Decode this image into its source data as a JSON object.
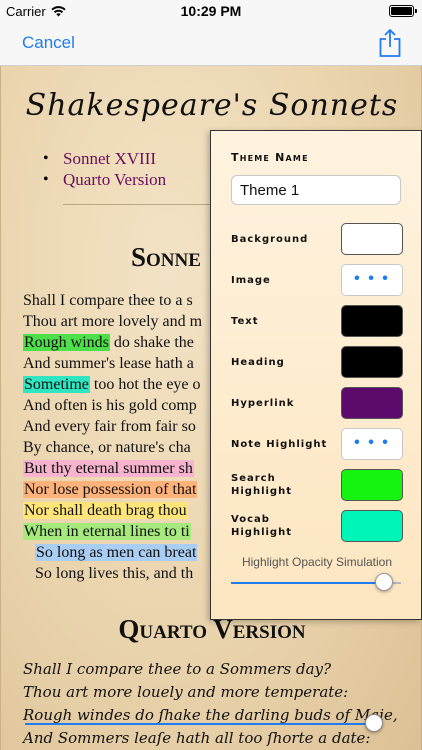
{
  "status_bar": {
    "carrier": "Carrier",
    "time": "10:29 PM",
    "wifi_icon": "wifi-icon",
    "battery_icon": "battery-icon",
    "battery_level": 1.0
  },
  "nav": {
    "cancel_label": "Cancel",
    "share_icon": "share-icon",
    "accent_color": "#1f7cf0"
  },
  "book": {
    "title": "Shakespeare's Sonnets",
    "toc": [
      {
        "label": "Sonnet XVIII",
        "link_color": "#6b0f5b"
      },
      {
        "label": "Quarto Version",
        "link_color": "#6b0f5b"
      }
    ],
    "heading_1": "Sonne",
    "lines": [
      {
        "pre": "Shall I compare thee to a s",
        "hl": "",
        "post": "",
        "color": ""
      },
      {
        "pre": "Thou art more lovely and m",
        "hl": "",
        "post": "",
        "color": ""
      },
      {
        "pre": "",
        "hl": "Rough winds",
        "post": " do shake the",
        "color": "#4ee04a"
      },
      {
        "pre": "And summer's lease hath a",
        "hl": "",
        "post": "",
        "color": ""
      },
      {
        "pre": "",
        "hl": "Sometime",
        "post": " too hot the eye o",
        "color": "#2ee6c1"
      },
      {
        "pre": "And often is his gold comp",
        "hl": "",
        "post": "",
        "color": ""
      },
      {
        "pre": "And every fair from fair so",
        "hl": "",
        "post": "",
        "color": ""
      },
      {
        "pre": "By chance, or nature's cha",
        "hl": "",
        "post": "",
        "color": ""
      },
      {
        "pre": "",
        "hl": "But thy eternal summer sh",
        "post": "",
        "color": "#f7b3cf"
      },
      {
        "pre": "",
        "hl": "Nor lose possession of that",
        "post": "",
        "color": "#ffb27a"
      },
      {
        "pre": "",
        "hl": "Nor shall death brag thou",
        "post": "",
        "color": "#fde57a"
      },
      {
        "pre": "",
        "hl": "When in eternal lines to ti",
        "post": "",
        "color": "#a6ea7e"
      },
      {
        "pre": "",
        "hl": "So long as men can breat",
        "post": "",
        "color": "#a9cdf3",
        "indent": true
      },
      {
        "pre": "So long lives this, and th",
        "hl": "",
        "post": "",
        "color": "",
        "indent": true
      }
    ],
    "heading_2": "Quarto Version",
    "quarto_lines": [
      "Shall I compare thee to a Sommers day?",
      "Thou art more louely and more temperate:",
      "Rough windes do ſhake the darling buds of Maie,",
      "And Sommers leaſe hath all too ſhorte a date:"
    ],
    "page_slider": {
      "value": 0.98
    }
  },
  "theme_panel": {
    "title": "Theme Name",
    "theme_name_value": "Theme 1",
    "rows": [
      {
        "label": "Background",
        "type": "color",
        "color": "#ffffff"
      },
      {
        "label": "Image",
        "type": "dots",
        "dots": "• • •"
      },
      {
        "label": "Text",
        "type": "color",
        "color": "#000000"
      },
      {
        "label": "Heading",
        "type": "color",
        "color": "#000000"
      },
      {
        "label": "Hyperlink",
        "type": "color",
        "color": "#5c0a6b"
      },
      {
        "label": "Note Highlight",
        "type": "dots",
        "dots": "• • •"
      },
      {
        "label": "Search Highlight",
        "type": "color",
        "color": "#16f512"
      },
      {
        "label": "Vocab Highlight",
        "type": "color",
        "color": "#00f5b9"
      }
    ],
    "opacity_caption": "Highlight Opacity Simulation",
    "opacity_value": 0.9
  }
}
